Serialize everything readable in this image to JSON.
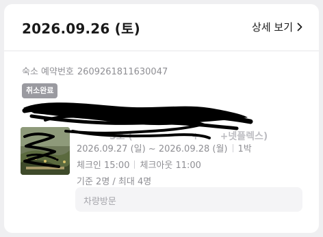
{
  "reservation": {
    "date_title": "2026.09.26 (토)",
    "details_link": "상세 보기",
    "booking_label": "숙소 예약번호",
    "booking_number": "2609261811630047",
    "status_badge": "취소완료",
    "room_name_partial": "3호 (",
    "room_name_partial2": "+",
    "room_name_suffix": "+넷플렉스)",
    "stay_dates": "2026.09.27 (일) ~ 2026.09.28 (월)",
    "nights": "1박",
    "checkin": "체크인 15:00",
    "checkout": "체크아웃 11:00",
    "guests": "기준 2명 / 최대 4명",
    "visit_placeholder": "차량방문"
  },
  "colors": {
    "badge_bg": "#9a9aa0",
    "secondary_text": "#8e8e93",
    "title_text": "#1a1a1a",
    "redaction": "#000000"
  },
  "icons": {
    "details_chevron": "chevron-right-icon"
  }
}
